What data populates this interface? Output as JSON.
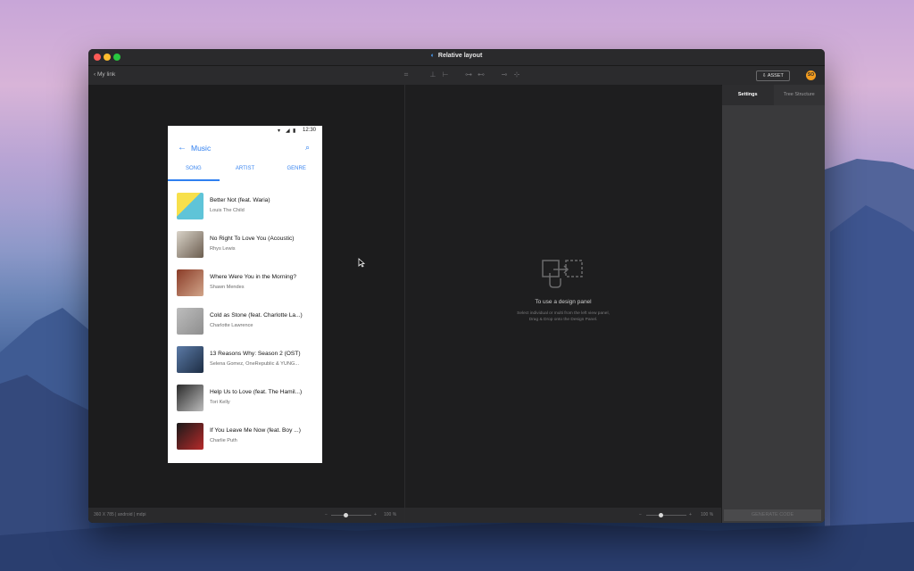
{
  "window": {
    "title": "Relative layout"
  },
  "toolbar": {
    "back_label": "My link",
    "asset_label": "ASSET",
    "avatar_initials": "SO"
  },
  "phone": {
    "time": "12:30",
    "app_title": "Music",
    "tabs": [
      "SONG",
      "ARTIST",
      "GENRE"
    ],
    "songs": [
      {
        "title": "Better Not (feat. Waria)",
        "artist": "Louis The Child"
      },
      {
        "title": "No Right To Love You (Acoustic)",
        "artist": "Rhys Lewis"
      },
      {
        "title": "Where Were You in the Morning?",
        "artist": "Shawn Mendes"
      },
      {
        "title": "Cold as Stone (feat. Charlotte La...)",
        "artist": "Charlotte Lawrence"
      },
      {
        "title": "13 Reasons Why: Season 2 (OST)",
        "artist": "Selena Gomez, OneRepublic & YUNG..."
      },
      {
        "title": "Help Us to Love (feat. The Hamil...)",
        "artist": "Tori Kelly"
      },
      {
        "title": "If You Leave Me Now (feat. Boy ...)",
        "artist": "Charlie Puth"
      }
    ]
  },
  "left_status": {
    "info": "360 X 785  |  android  |  mdpi",
    "zoom": "100 %"
  },
  "center_status": {
    "zoom": "100 %"
  },
  "design_panel": {
    "title": "To use a design panel",
    "line1": "Select individual or multi from the left view panel,",
    "line2": "Drag & Drop onto the Design Panel."
  },
  "right_panel": {
    "tabs": [
      "Settings",
      "Tree Structure"
    ],
    "generate_label": "GENERATE CODE"
  },
  "colors": {
    "accent": "#2f7ff0",
    "avatar": "#f29c1f"
  }
}
